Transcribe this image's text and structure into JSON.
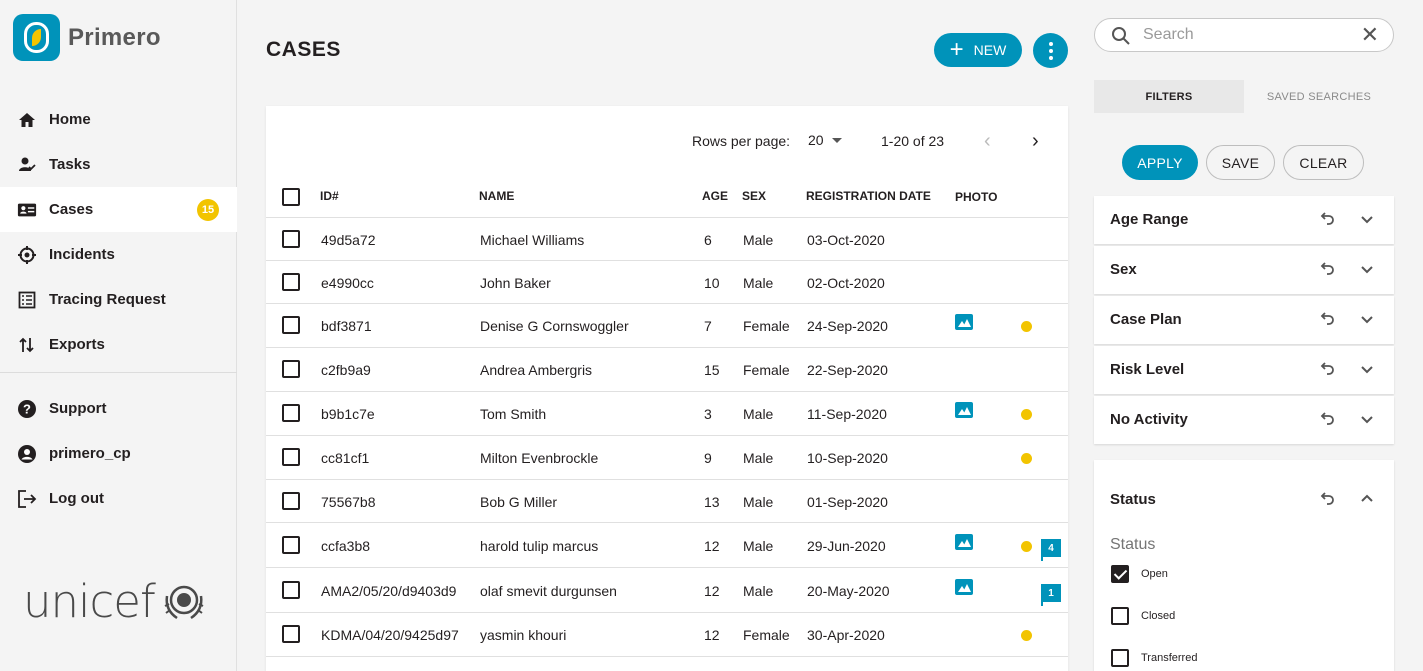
{
  "app": {
    "name": "Primero",
    "partner": "unicef"
  },
  "nav": {
    "items": [
      {
        "label": "Home",
        "icon": "home-icon"
      },
      {
        "label": "Tasks",
        "icon": "tasks-icon"
      },
      {
        "label": "Cases",
        "icon": "cases-icon",
        "badge": "15",
        "active": true
      },
      {
        "label": "Incidents",
        "icon": "incidents-icon"
      },
      {
        "label": "Tracing Request",
        "icon": "tracing-request-icon"
      },
      {
        "label": "Exports",
        "icon": "exports-icon"
      }
    ],
    "secondary": [
      {
        "label": "Support",
        "icon": "help-icon"
      },
      {
        "label": "primero_cp",
        "icon": "account-icon"
      },
      {
        "label": "Log out",
        "icon": "logout-icon"
      }
    ]
  },
  "header": {
    "title": "CASES",
    "new_label": "NEW"
  },
  "pagination": {
    "rows_per_page_label": "Rows per page:",
    "rows_per_page": "20",
    "range": "1-20 of 23"
  },
  "table": {
    "columns": [
      "ID#",
      "NAME",
      "AGE",
      "SEX",
      "REGISTRATION DATE",
      "PHOTO"
    ],
    "rows": [
      {
        "id": "49d5a72",
        "name": "Michael Williams",
        "age": "6",
        "sex": "Male",
        "date": "03-Oct-2020",
        "photo": false,
        "alert": false,
        "flag": ""
      },
      {
        "id": "e4990cc",
        "name": "John Baker",
        "age": "10",
        "sex": "Male",
        "date": "02-Oct-2020",
        "photo": false,
        "alert": false,
        "flag": ""
      },
      {
        "id": "bdf3871",
        "name": "Denise G Cornswoggler",
        "age": "7",
        "sex": "Female",
        "date": "24-Sep-2020",
        "photo": true,
        "alert": true,
        "flag": ""
      },
      {
        "id": "c2fb9a9",
        "name": "Andrea Ambergris",
        "age": "15",
        "sex": "Female",
        "date": "22-Sep-2020",
        "photo": false,
        "alert": false,
        "flag": ""
      },
      {
        "id": "b9b1c7e",
        "name": "Tom Smith",
        "age": "3",
        "sex": "Male",
        "date": "11-Sep-2020",
        "photo": true,
        "alert": true,
        "flag": ""
      },
      {
        "id": "cc81cf1",
        "name": "Milton Evenbrockle",
        "age": "9",
        "sex": "Male",
        "date": "10-Sep-2020",
        "photo": false,
        "alert": true,
        "flag": ""
      },
      {
        "id": "75567b8",
        "name": "Bob G Miller",
        "age": "13",
        "sex": "Male",
        "date": "01-Sep-2020",
        "photo": false,
        "alert": false,
        "flag": ""
      },
      {
        "id": "ccfa3b8",
        "name": "harold tulip marcus",
        "age": "12",
        "sex": "Male",
        "date": "29-Jun-2020",
        "photo": true,
        "alert": true,
        "flag": "4"
      },
      {
        "id": "AMA2/05/20/d9403d9",
        "name": "olaf smevit durgunsen",
        "age": "12",
        "sex": "Male",
        "date": "20-May-2020",
        "photo": true,
        "alert": false,
        "flag": "1"
      },
      {
        "id": "KDMA/04/20/9425d97",
        "name": "yasmin khouri",
        "age": "12",
        "sex": "Female",
        "date": "30-Apr-2020",
        "photo": false,
        "alert": true,
        "flag": ""
      }
    ]
  },
  "search": {
    "placeholder": "Search"
  },
  "filter_tabs": {
    "filters": "FILTERS",
    "saved": "SAVED SEARCHES"
  },
  "filter_buttons": {
    "apply": "APPLY",
    "save": "SAVE",
    "clear": "CLEAR"
  },
  "filters": [
    "Age Range",
    "Sex",
    "Case Plan",
    "Risk Level",
    "No Activity"
  ],
  "status_filter": {
    "title": "Status",
    "sublabel": "Status",
    "options": [
      {
        "label": "Open",
        "checked": true
      },
      {
        "label": "Closed",
        "checked": false
      },
      {
        "label": "Transferred",
        "checked": false
      }
    ]
  },
  "colors": {
    "accent": "#0093ba",
    "badge": "#f2c400"
  }
}
